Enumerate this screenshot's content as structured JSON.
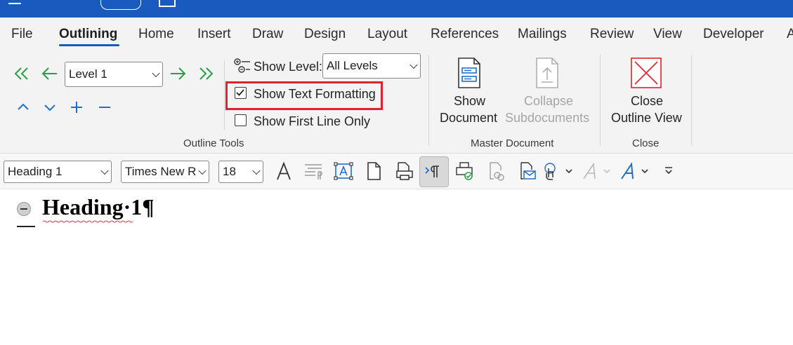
{
  "menu": {
    "tabs": [
      "File",
      "Outlining",
      "Home",
      "Insert",
      "Draw",
      "Design",
      "Layout",
      "References",
      "Mailings",
      "Review",
      "View",
      "Developer",
      "A"
    ],
    "active": "Outlining"
  },
  "outline_tools": {
    "level_value": "Level 1",
    "show_level_label": "Show Level:",
    "show_level_value": "All Levels",
    "show_text_formatting_label": "Show Text Formatting",
    "show_text_formatting_checked": true,
    "show_first_line_only_label": "Show First Line Only",
    "show_first_line_only_checked": false,
    "group_label": "Outline Tools"
  },
  "master_document": {
    "show_document_label_1": "Show",
    "show_document_label_2": "Document",
    "collapse_label_1": "Collapse",
    "collapse_label_2": "Subdocuments",
    "group_label": "Master Document"
  },
  "close_group": {
    "close_label_1": "Close",
    "close_label_2": "Outline View",
    "group_label": "Close"
  },
  "toolbar": {
    "style_value": "Heading 1",
    "font_value": "Times New R",
    "size_value": "18"
  },
  "document": {
    "heading_text": "Heading·1¶"
  },
  "colors": {
    "title_bar": "#185abd",
    "arrow_green": "#27a046",
    "accent_blue": "#1f6fcf",
    "highlight_red": "#e0212e"
  }
}
